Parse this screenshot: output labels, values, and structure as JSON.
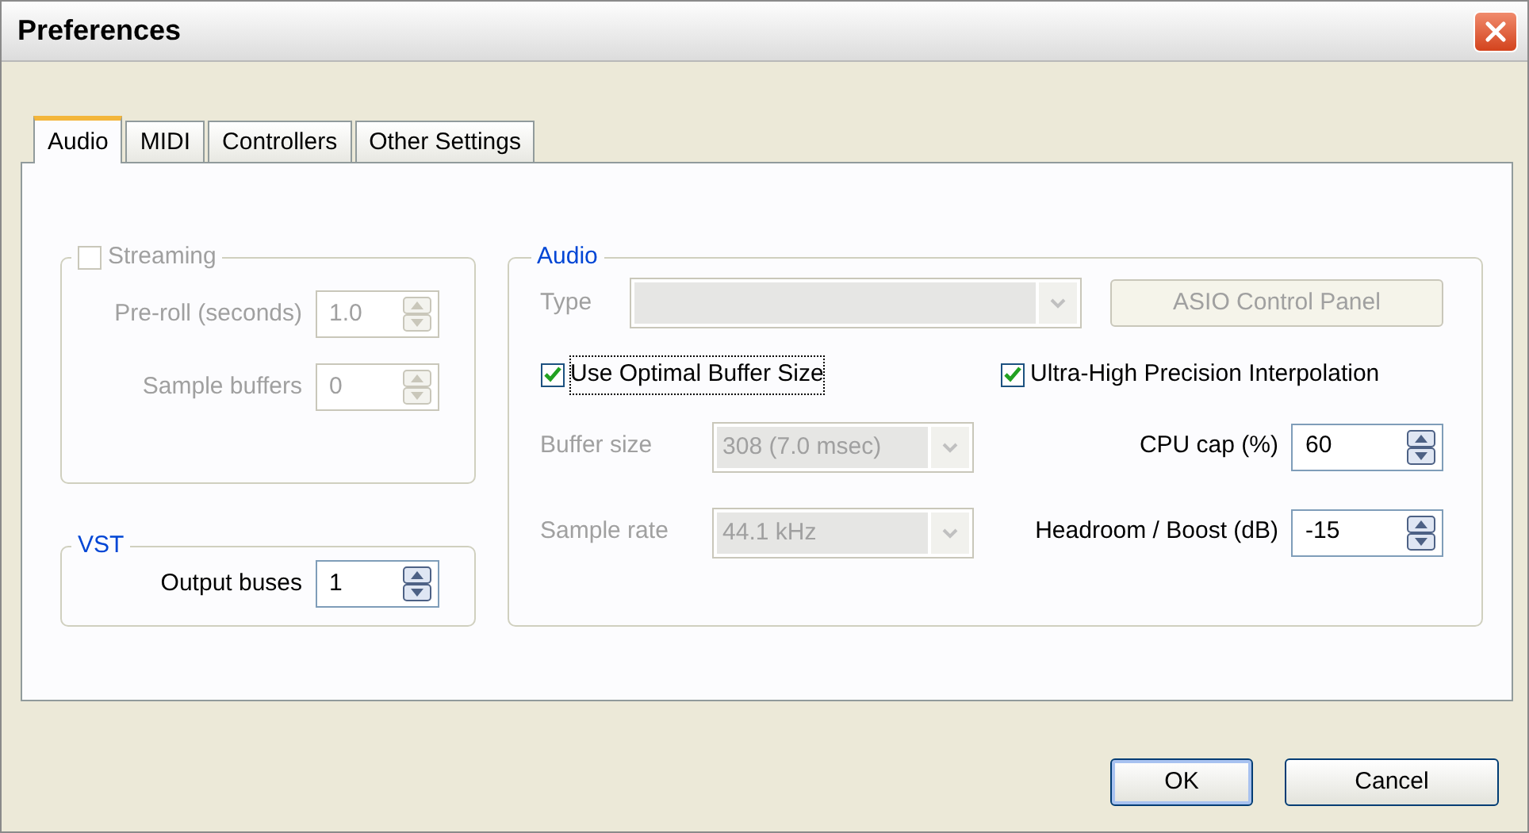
{
  "window": {
    "title": "Preferences"
  },
  "tabs": [
    {
      "label": "Audio",
      "selected": true
    },
    {
      "label": "MIDI",
      "selected": false
    },
    {
      "label": "Controllers",
      "selected": false
    },
    {
      "label": "Other Settings",
      "selected": false
    }
  ],
  "streaming": {
    "label": "Streaming",
    "checked": false,
    "disabled": true,
    "fields": [
      {
        "label": "Pre-roll (seconds)",
        "value": "1.0",
        "disabled": true
      },
      {
        "label": "Sample buffers",
        "value": "0",
        "disabled": true
      }
    ]
  },
  "vst": {
    "title": "VST",
    "fields": [
      {
        "label": "Output buses",
        "value": "1",
        "disabled": false
      }
    ]
  },
  "audio": {
    "title": "Audio",
    "type": {
      "label": "Type",
      "disabled": true
    },
    "asio_button": {
      "label": "ASIO Control Panel",
      "disabled": true
    },
    "checkboxes": [
      {
        "label": "Use Optimal Buffer Size",
        "checked": true,
        "focused": true
      },
      {
        "label": "Ultra-High Precision Interpolation",
        "checked": true,
        "focused": false
      }
    ],
    "rows": [
      {
        "select": {
          "label": "Buffer size",
          "value": "308 (7.0 msec)",
          "disabled": true
        },
        "spinner": {
          "label": "CPU cap (%)",
          "value": "60",
          "disabled": false
        }
      },
      {
        "select": {
          "label": "Sample rate",
          "value": "44.1 kHz",
          "disabled": true
        },
        "spinner": {
          "label": "Headroom / Boost (dB)",
          "value": "-15",
          "disabled": false
        }
      }
    ]
  },
  "buttons": [
    {
      "label": "OK",
      "default": true
    },
    {
      "label": "Cancel",
      "default": false
    }
  ]
}
